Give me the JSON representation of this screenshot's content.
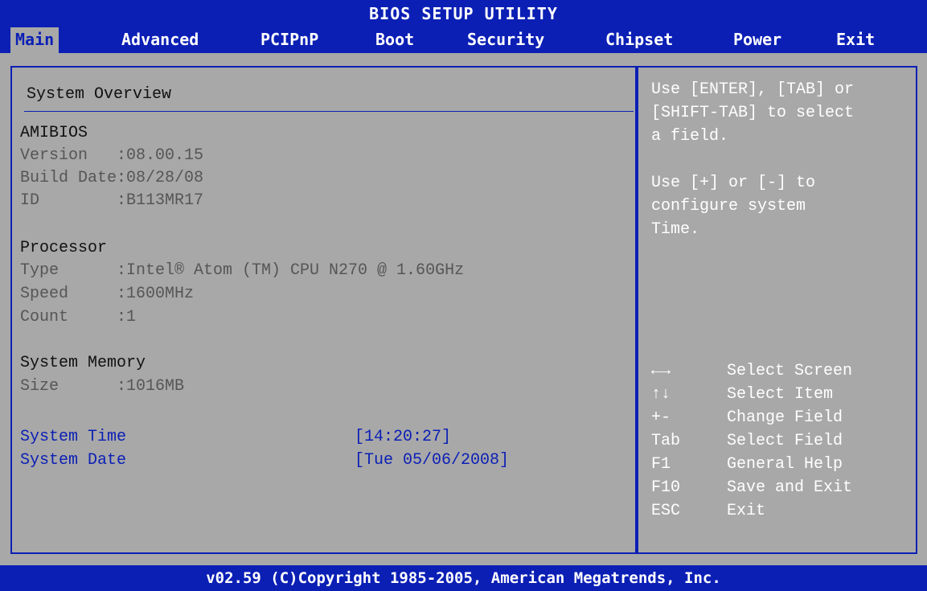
{
  "title": "BIOS SETUP UTILITY",
  "menu": {
    "main": "Main",
    "advanced": "Advanced",
    "pcipnp": "PCIPnP",
    "boot": "Boot",
    "security": "Security",
    "chipset": "Chipset",
    "power": "Power",
    "exit": "Exit",
    "active": "Main"
  },
  "overview": {
    "heading": "System Overview",
    "amibios": {
      "title": "AMIBIOS",
      "version_label": "Version   ",
      "version_value": ":08.00.15",
      "build_label": "Build Date",
      "build_value": ":08/28/08",
      "id_label": "ID        ",
      "id_value": ":B113MR17"
    },
    "processor": {
      "title": "Processor",
      "type_label": "Type      ",
      "type_value": ":Intel® Atom (TM) CPU N270 @ 1.60GHz",
      "speed_label": "Speed     ",
      "speed_value": ":1600MHz",
      "count_label": "Count     ",
      "count_value": ":1"
    },
    "memory": {
      "title": "System Memory",
      "size_label": "Size      ",
      "size_value": ":1016MB"
    },
    "time_label": "System Time",
    "time_value": "[14:20:27]",
    "date_label": "System Date",
    "date_value": "[Tue 05/06/2008]"
  },
  "help": {
    "line1": "Use [ENTER], [TAB] or",
    "line2": "[SHIFT-TAB] to select",
    "line3": "a field.",
    "line4": "Use [+] or [-] to",
    "line5": "configure system",
    "line6": "Time."
  },
  "keys": [
    {
      "key": "←→",
      "desc": "Select Screen"
    },
    {
      "key": "↑↓",
      "desc": "Select Item"
    },
    {
      "key": "+-",
      "desc": "Change Field"
    },
    {
      "key": "Tab",
      "desc": "Select Field"
    },
    {
      "key": "F1",
      "desc": "General Help"
    },
    {
      "key": "F10",
      "desc": "Save and Exit"
    },
    {
      "key": "ESC",
      "desc": "Exit"
    }
  ],
  "footer": "v02.59 (C)Copyright 1985-2005, American Megatrends, Inc.",
  "colors": {
    "bios_blue": "#0b1fb5",
    "panel_grey": "#a8a8a8",
    "label_grey": "#565656",
    "text_white": "#ffffff"
  }
}
